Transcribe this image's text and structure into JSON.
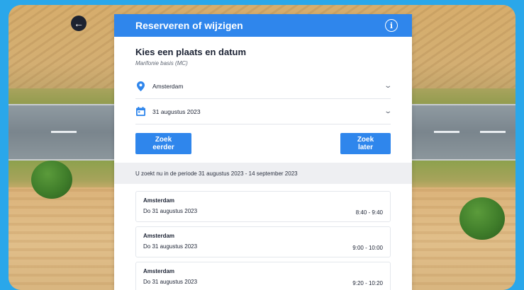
{
  "header": {
    "title": "Reserveren of wijzigen",
    "back_icon": "arrow-left-icon",
    "info_icon": "info-icon"
  },
  "section": {
    "title": "Kies een plaats en datum",
    "subtitle": "Marifonie basis (MC)"
  },
  "filters": {
    "location": {
      "icon": "location-pin-icon",
      "value": "Amsterdam"
    },
    "date": {
      "icon": "calendar-icon",
      "value": "31 augustus 2023"
    }
  },
  "buttons": {
    "earlier": "Zoek eerder",
    "later": "Zoek later"
  },
  "period_text": "U zoekt nu in de periode 31 augustus 2023 - 14 september 2023",
  "slots": [
    {
      "place": "Amsterdam",
      "date": "Do 31 augustus 2023",
      "time": "8:40 - 9:40"
    },
    {
      "place": "Amsterdam",
      "date": "Do 31 augustus 2023",
      "time": "9:00 - 10:00"
    },
    {
      "place": "Amsterdam",
      "date": "Do 31 augustus 2023",
      "time": "9:20 - 10:20"
    }
  ],
  "colors": {
    "accent": "#2f86ec",
    "outer_background": "#2aa7ea",
    "period_bar": "#eeeff2"
  }
}
